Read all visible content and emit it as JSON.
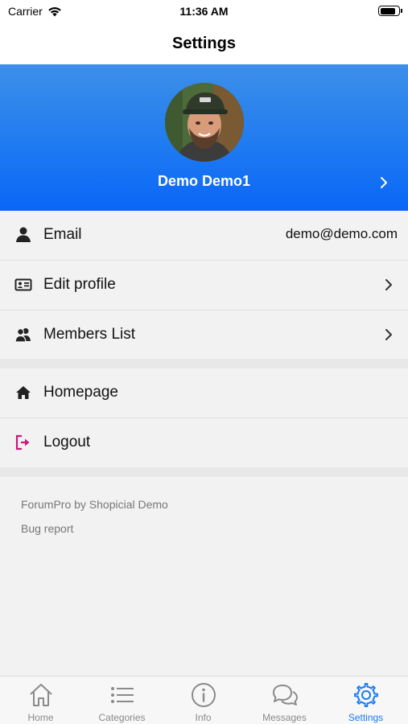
{
  "status_bar": {
    "carrier": "Carrier",
    "time": "11:36 AM",
    "battery_level": 0.85
  },
  "nav": {
    "title": "Settings"
  },
  "profile": {
    "name": "Demo Demo1",
    "gradient_colors": [
      "#3d8fe8",
      "#0a66f7"
    ]
  },
  "menu": {
    "email": {
      "label": "Email",
      "value": "demo@demo.com",
      "icon": "user-icon"
    },
    "edit_profile": {
      "label": "Edit profile",
      "icon": "id-card-icon"
    },
    "members_list": {
      "label": "Members List",
      "icon": "members-icon"
    },
    "homepage": {
      "label": "Homepage",
      "icon": "home-icon"
    },
    "logout": {
      "label": "Logout",
      "icon": "logout-icon",
      "color": "#d0157a"
    }
  },
  "footer": {
    "credit": "ForumPro by Shopicial Demo",
    "bug_report": "Bug report"
  },
  "tabs": [
    {
      "label": "Home",
      "icon": "home-icon",
      "active": false
    },
    {
      "label": "Categories",
      "icon": "list-icon",
      "active": false
    },
    {
      "label": "Info",
      "icon": "info-icon",
      "active": false
    },
    {
      "label": "Messages",
      "icon": "messages-icon",
      "active": false
    },
    {
      "label": "Settings",
      "icon": "gear-icon",
      "active": true
    }
  ],
  "colors": {
    "accent": "#1a7bf0",
    "tab_inactive": "#8a8a8a"
  }
}
